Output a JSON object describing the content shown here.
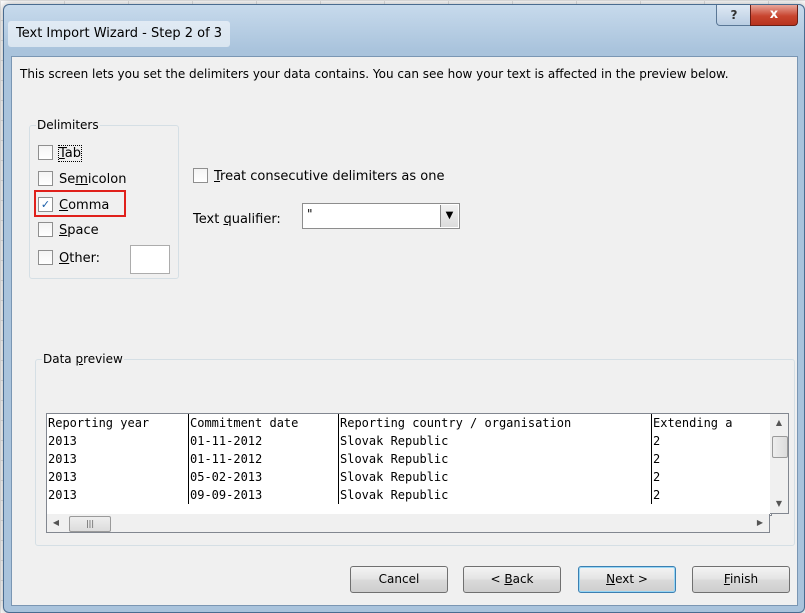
{
  "dialog": {
    "title": "Text Import Wizard - Step 2 of 3",
    "help_glyph": "?",
    "close_glyph": "x",
    "intro": "This screen lets you set the delimiters your data contains.  You can see how your text is affected in the preview below."
  },
  "delimiters": {
    "group_label": "Delimiters",
    "tab": {
      "pre": "",
      "key": "T",
      "post": "ab",
      "checked": false
    },
    "semicolon": {
      "pre": "Se",
      "key": "m",
      "post": "icolon",
      "checked": false
    },
    "comma": {
      "pre": "",
      "key": "C",
      "post": "omma",
      "checked": true
    },
    "space": {
      "pre": "",
      "key": "S",
      "post": "pace",
      "checked": false
    },
    "other": {
      "pre": "",
      "key": "O",
      "post": "ther:",
      "checked": false,
      "value": ""
    },
    "consecutive": {
      "pre": "",
      "key": "T",
      "post": "reat consecutive delimiters as one",
      "checked": false
    }
  },
  "qualifier": {
    "pre": "Text ",
    "key": "q",
    "post": "ualifier:",
    "value": "\""
  },
  "preview": {
    "group_label_pre": "Data ",
    "group_label_key": "p",
    "group_label_post": "review",
    "rows": [
      [
        "Reporting year",
        "Commitment date",
        "Reporting country / organisation",
        "Extending a"
      ],
      [
        "2013",
        "01-11-2012",
        "Slovak Republic",
        "2"
      ],
      [
        "2013",
        "01-11-2012",
        "Slovak Republic",
        "2"
      ],
      [
        "2013",
        "05-02-2013",
        "Slovak Republic",
        "2"
      ],
      [
        "2013",
        "09-09-2013",
        "Slovak Republic",
        "2"
      ]
    ]
  },
  "buttons": {
    "cancel": "Cancel",
    "back": {
      "pre": "< ",
      "key": "B",
      "post": "ack"
    },
    "next": {
      "pre": "",
      "key": "N",
      "post": "ext >"
    },
    "finish": {
      "pre": "",
      "key": "F",
      "post": "inish"
    }
  },
  "icons": {
    "check": "✓",
    "dropdown": "▼",
    "up": "▲",
    "down": "▼",
    "left": "◀",
    "right": "▶",
    "grip": "|||"
  }
}
